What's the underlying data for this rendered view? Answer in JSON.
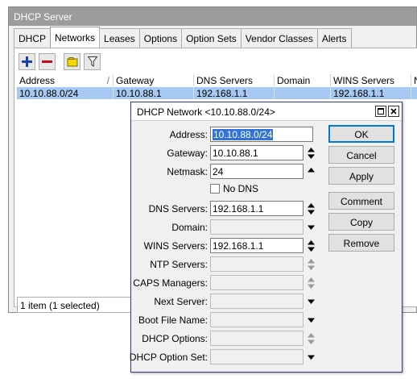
{
  "main_window": {
    "title": "DHCP Server",
    "tabs": [
      {
        "label": "DHCP"
      },
      {
        "label": "Networks"
      },
      {
        "label": "Leases"
      },
      {
        "label": "Options"
      },
      {
        "label": "Option Sets"
      },
      {
        "label": "Vendor Classes"
      },
      {
        "label": "Alerts"
      }
    ],
    "toolbar": {
      "add_icon": "plus-icon",
      "remove_icon": "minus-icon",
      "comment_icon": "note-icon",
      "filter_icon": "filter-icon"
    },
    "grid": {
      "columns": [
        "Address",
        "Gateway",
        "DNS Servers",
        "Domain",
        "WINS Servers",
        "Ne"
      ],
      "rows": [
        [
          "10.10.88.0/24",
          "10.10.88.1",
          "192.168.1.1",
          "",
          "192.168.1.1",
          ""
        ]
      ]
    },
    "status": "1 item (1 selected)"
  },
  "dialog": {
    "title": "DHCP Network <10.10.88.0/24>",
    "fields": {
      "address": {
        "label": "Address:",
        "value": "10.10.88.0/24"
      },
      "gateway": {
        "label": "Gateway:",
        "value": "10.10.88.1"
      },
      "netmask": {
        "label": "Netmask:",
        "value": "24"
      },
      "no_dns": {
        "label": "No DNS",
        "checked": false
      },
      "dns_servers": {
        "label": "DNS Servers:",
        "value": "192.168.1.1"
      },
      "domain": {
        "label": "Domain:",
        "value": ""
      },
      "wins_servers": {
        "label": "WINS Servers:",
        "value": "192.168.1.1"
      },
      "ntp_servers": {
        "label": "NTP Servers:",
        "value": ""
      },
      "caps_managers": {
        "label": "CAPS Managers:",
        "value": ""
      },
      "next_server": {
        "label": "Next Server:",
        "value": ""
      },
      "boot_file_name": {
        "label": "Boot File Name:",
        "value": ""
      },
      "dhcp_options": {
        "label": "DHCP Options:",
        "value": ""
      },
      "dhcp_option_set": {
        "label": "DHCP Option Set:",
        "value": ""
      }
    },
    "buttons": {
      "ok": "OK",
      "cancel": "Cancel",
      "apply": "Apply",
      "comment": "Comment",
      "copy": "Copy",
      "remove": "Remove"
    }
  },
  "colors": {
    "selection": "#a6c8f2",
    "add_icon": "#1a3fa8",
    "remove_icon": "#c0101c",
    "comment_icon": "#f5d800",
    "focus_border": "#0078d7"
  }
}
